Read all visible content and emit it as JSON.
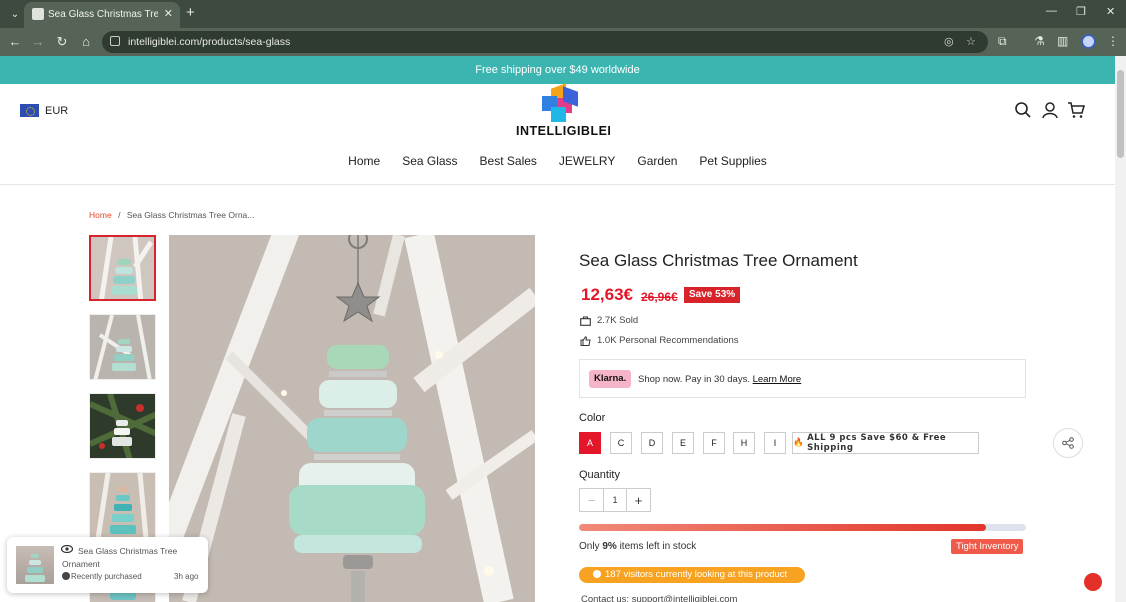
{
  "browser": {
    "tab_title": "Sea Glass Christmas Tree Ornament",
    "url": "intelligiblei.com/products/sea-glass",
    "new_tab_label": "+",
    "tab_close_label": "✕"
  },
  "announcement": "Free shipping over $49 worldwide",
  "header": {
    "currency": "EUR",
    "logo_text": "INTELLIGIBLEI"
  },
  "nav": {
    "items": [
      "Home",
      "Sea Glass",
      "Best Sales",
      "JEWELRY",
      "Garden",
      "Pet Supplies"
    ]
  },
  "breadcrumb": {
    "home": "Home",
    "separator": "/",
    "current": "Sea Glass Christmas Tree Orna..."
  },
  "popup": {
    "title": "Sea Glass Christmas Tree Ornament",
    "status": "Recently purchased",
    "time": "3h ago"
  },
  "product": {
    "title": "Sea Glass Christmas Tree Ornament",
    "price": "12,63€",
    "compare_price": "26,96€",
    "save_badge": "Save 53%",
    "sold": "2.7K Sold",
    "recommendations": "1.0K Personal Recommendations",
    "klarna": {
      "badge": "Klarna.",
      "text": "Shop now. Pay in 30 days.",
      "link": "Learn More"
    },
    "color_label": "Color",
    "colors": [
      "A",
      "C",
      "D",
      "E",
      "F",
      "H",
      "I"
    ],
    "selected_color": "A",
    "bundle_option": "ALL 9 pcs Save $60 & Free Shipping",
    "quantity_label": "Quantity",
    "quantity": "1",
    "qty_minus": "−",
    "qty_plus": "+",
    "stock_fraction": 0.91,
    "stock_prefix": "Only",
    "stock_percent": "9%",
    "stock_suffix": "items left in stock",
    "tight_badge": "Tight Inventory",
    "visitors": "187 visitors currently looking at this product",
    "contact": "Contact us: support@intelligiblei.com"
  },
  "colors": {
    "announcement_bg": "#3cb5b0",
    "accent_red": "#e3162a",
    "visitors_bg": "#f7a321",
    "klarna_pink": "#f6b4c8"
  }
}
